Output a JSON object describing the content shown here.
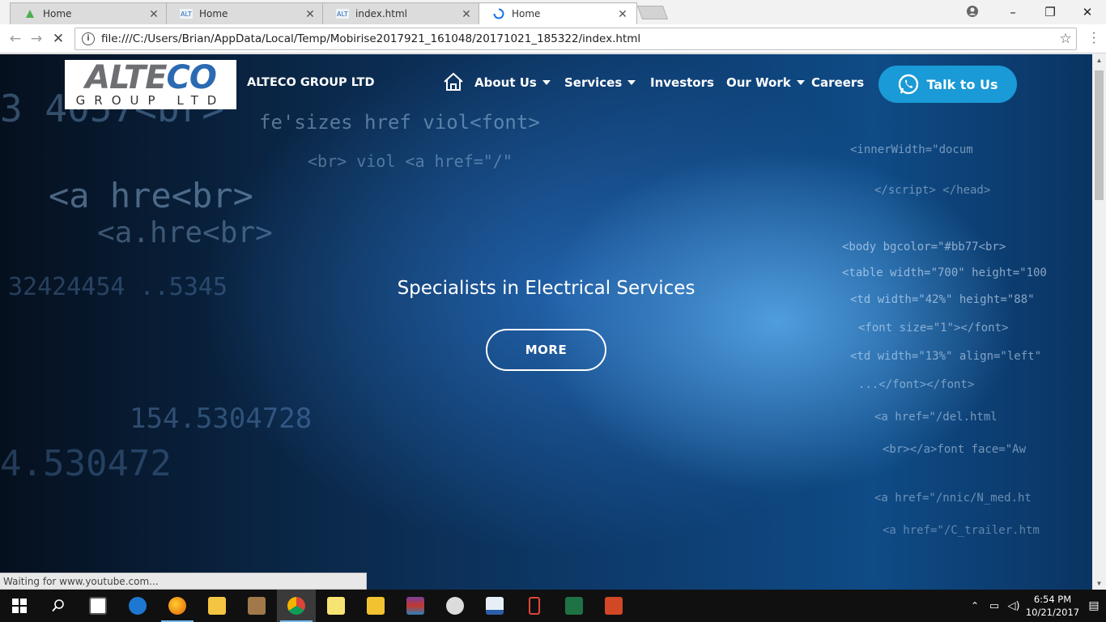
{
  "browser": {
    "tabs": [
      {
        "title": "Home",
        "active": false
      },
      {
        "title": "Home",
        "active": false
      },
      {
        "title": "index.html",
        "active": false
      },
      {
        "title": "Home",
        "active": true
      }
    ],
    "url": "file:///C:/Users/Brian/AppData/Local/Temp/Mobirise2017921_161048/20171021_185322/index.html",
    "status": "Waiting for www.youtube.com..."
  },
  "site": {
    "logo_main_1": "ALTE",
    "logo_main_2": "CO",
    "logo_sub": "GROUP LTD",
    "brand_name": "ALTECO GROUP LTD",
    "nav": [
      {
        "label": "About Us",
        "dropdown": true
      },
      {
        "label": "Services",
        "dropdown": true
      },
      {
        "label": "Investors",
        "dropdown": false
      },
      {
        "label": "Our Work",
        "dropdown": true
      },
      {
        "label": "Careers",
        "dropdown": false
      }
    ],
    "cta_label": "Talk to Us",
    "hero_title": "Specialists in Electrical Services",
    "more_label": "MORE"
  },
  "taskbar": {
    "time": "6:54 PM",
    "date": "10/21/2017",
    "apps": [
      "start-button",
      "search",
      "store",
      "edge",
      "firefox",
      "file-explorer",
      "photo-app",
      "chrome",
      "sticky-notes",
      "outlook",
      "winrar",
      "paint",
      "pdf-tool",
      "mobile-tool",
      "excel",
      "powerpoint"
    ]
  },
  "colors": {
    "cta": "#1a9ad6",
    "logo_blue": "#2b6ab3"
  }
}
